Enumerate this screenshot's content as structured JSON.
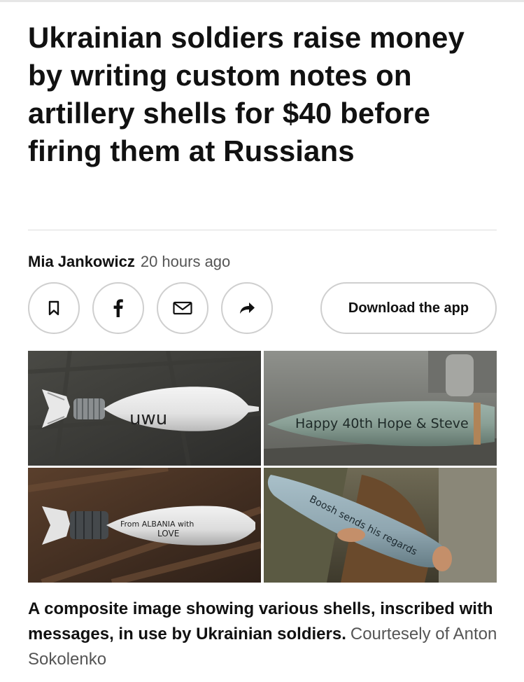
{
  "article": {
    "headline": "Ukrainian soldiers raise money by writing custom notes on artillery shells for $40 before firing them at Russians",
    "author": "Mia Jankowicz",
    "time": "20 hours ago"
  },
  "actions": {
    "icons": [
      "bookmark-icon",
      "facebook-icon",
      "email-icon",
      "share-icon"
    ],
    "download_label": "Download the app"
  },
  "photos": {
    "shell_texts": {
      "top_left": "uwu",
      "top_right": "Happy 40th Hope & Steve",
      "bottom_left_line1": "From ALBANIA with",
      "bottom_left_line2": "LOVE",
      "bottom_right": "Boosh sends his regards"
    }
  },
  "caption": {
    "text": "A composite image showing various shells, inscribed with messages, in use by Ukrainian soldiers.",
    "credit": "Courtesely of Anton Sokolenko"
  }
}
